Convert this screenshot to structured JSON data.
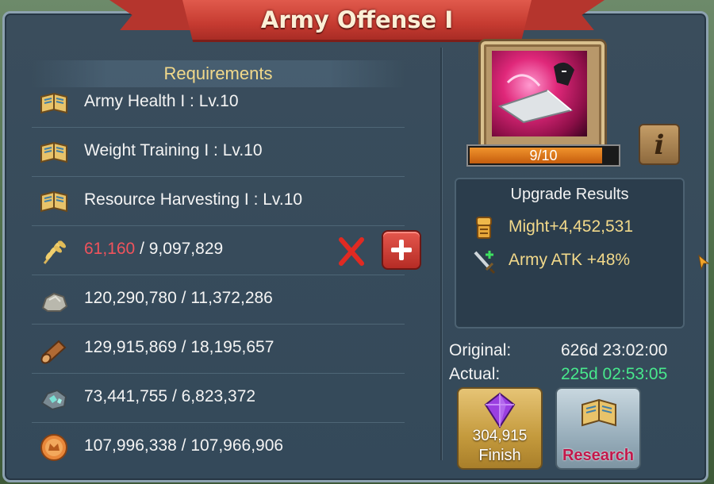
{
  "title": "Army Offense I",
  "requirements_header": "Requirements",
  "requirements": [
    {
      "icon": "research-book-icon",
      "text": "Army Health I : Lv.10"
    },
    {
      "icon": "research-book-icon",
      "text": "Weight Training I : Lv.10"
    },
    {
      "icon": "research-book-icon",
      "text": "Resource Harvesting I : Lv.10"
    }
  ],
  "resources": [
    {
      "icon": "food-wheat-icon",
      "have": "61,160",
      "need": "9,097,829",
      "sufficient": false
    },
    {
      "icon": "stone-icon",
      "have": "120,290,780",
      "need": "11,372,286",
      "sufficient": true
    },
    {
      "icon": "timber-log-icon",
      "have": "129,915,869",
      "need": "18,195,657",
      "sufficient": true
    },
    {
      "icon": "ore-icon",
      "have": "73,441,755",
      "need": "6,823,372",
      "sufficient": true
    },
    {
      "icon": "gold-coin-icon",
      "have": "107,996,338",
      "need": "107,966,906",
      "sufficient": true
    }
  ],
  "separator": " / ",
  "skill": {
    "level_text": "9/10",
    "progress": 0.9,
    "info_label": "i"
  },
  "upgrade_results": {
    "title": "Upgrade Results",
    "might": "Might+4,452,531",
    "army_atk": "Army ATK +48%"
  },
  "time": {
    "original_label": "Original:",
    "original_value": "626d 23:02:00",
    "actual_label": "Actual:",
    "actual_value": "225d 02:53:05"
  },
  "finish_button": {
    "cost": "304,915",
    "label": "Finish"
  },
  "research_button": {
    "label": "Research"
  },
  "colors": {
    "insufficient": "#f0535c",
    "actual_time": "#48e88c",
    "gold_text": "#f2d98a",
    "banner": "#c63b31"
  }
}
